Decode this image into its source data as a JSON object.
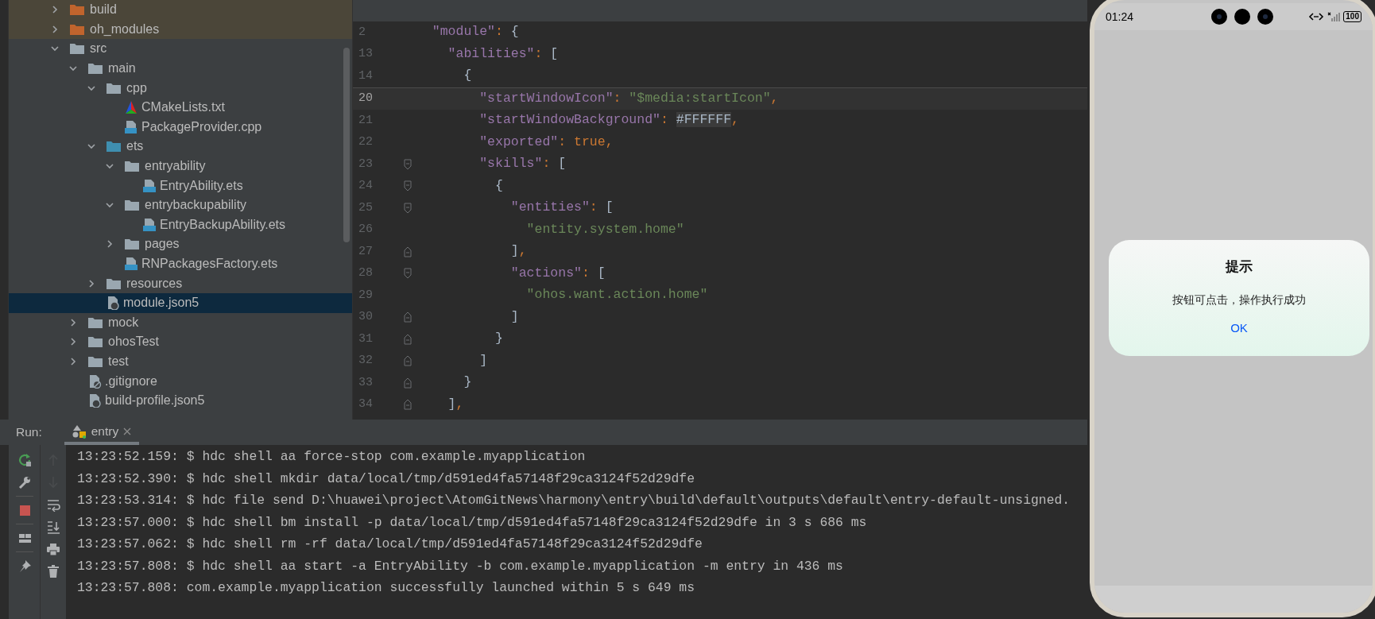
{
  "project_tree": [
    {
      "name": "build",
      "kind": "excluded-folder",
      "expanded": false,
      "selected": false
    },
    {
      "name": "oh_modules",
      "kind": "excluded-folder",
      "expanded": false,
      "selected": false
    },
    {
      "name": "src",
      "kind": "folder",
      "expanded": true,
      "selected": false,
      "children": [
        {
          "name": "main",
          "kind": "folder",
          "expanded": true,
          "selected": false,
          "children": [
            {
              "name": "cpp",
              "kind": "folder",
              "expanded": true,
              "selected": false,
              "children": [
                {
                  "name": "CMakeLists.txt",
                  "kind": "cmake-file",
                  "selected": false
                },
                {
                  "name": "PackageProvider.cpp",
                  "kind": "cpp-file",
                  "selected": false
                }
              ]
            },
            {
              "name": "ets",
              "kind": "source-folder",
              "expanded": true,
              "selected": false,
              "children": [
                {
                  "name": "entryability",
                  "kind": "folder",
                  "expanded": true,
                  "selected": false,
                  "children": [
                    {
                      "name": "EntryAbility.ets",
                      "kind": "ets-file",
                      "selected": false
                    }
                  ]
                },
                {
                  "name": "entrybackupability",
                  "kind": "folder",
                  "expanded": true,
                  "selected": false,
                  "children": [
                    {
                      "name": "EntryBackupAbility.ets",
                      "kind": "ets-file",
                      "selected": false
                    }
                  ]
                },
                {
                  "name": "pages",
                  "kind": "folder",
                  "expanded": false,
                  "selected": false
                },
                {
                  "name": "RNPackagesFactory.ets",
                  "kind": "ets-file",
                  "selected": false
                }
              ]
            },
            {
              "name": "resources",
              "kind": "folder",
              "expanded": false,
              "selected": false
            },
            {
              "name": "module.json5",
              "kind": "json-file",
              "selected": true
            }
          ]
        },
        {
          "name": "mock",
          "kind": "folder",
          "expanded": false,
          "selected": false
        },
        {
          "name": "ohosTest",
          "kind": "folder",
          "expanded": false,
          "selected": false
        },
        {
          "name": "test",
          "kind": "folder",
          "expanded": false,
          "selected": false
        },
        {
          "name": ".gitignore",
          "kind": "ignore-file",
          "selected": false
        },
        {
          "name": "build-profile.json5",
          "kind": "json-file",
          "selected": false
        }
      ]
    }
  ],
  "editor": {
    "sticky_lines": [
      {
        "number": "2",
        "current": false,
        "tokens": [
          {
            "text": "  \"module\"",
            "kind": "key"
          },
          {
            "text": ": ",
            "kind": "punct"
          },
          {
            "text": "{",
            "kind": "bracket"
          }
        ]
      },
      {
        "number": "13",
        "current": false,
        "tokens": [
          {
            "text": "    \"abilities\"",
            "kind": "key"
          },
          {
            "text": ": ",
            "kind": "punct"
          },
          {
            "text": "[",
            "kind": "bracket"
          }
        ]
      },
      {
        "number": "14",
        "current": false,
        "tokens": [
          {
            "text": "      {",
            "kind": "bracket"
          }
        ]
      }
    ],
    "lines": [
      {
        "number": "20",
        "current": true,
        "tokens": [
          {
            "text": "        \"startWindowIcon\"",
            "kind": "key"
          },
          {
            "text": ": ",
            "kind": "punct"
          },
          {
            "text": "\"$media:startIcon\"",
            "kind": "string"
          },
          {
            "text": ",",
            "kind": "punct"
          }
        ]
      },
      {
        "number": "21",
        "current": false,
        "tokens": [
          {
            "text": "        \"startWindowBackground\"",
            "kind": "key"
          },
          {
            "text": ": ",
            "kind": "punct"
          },
          {
            "text": "#FFFFFF",
            "kind": "marked"
          },
          {
            "text": ",",
            "kind": "punct"
          }
        ]
      },
      {
        "number": "22",
        "current": false,
        "tokens": [
          {
            "text": "        \"exported\"",
            "kind": "key"
          },
          {
            "text": ": ",
            "kind": "punct"
          },
          {
            "text": "true",
            "kind": "literal"
          },
          {
            "text": ",",
            "kind": "punct"
          }
        ]
      },
      {
        "number": "23",
        "current": false,
        "kind": "fold-start",
        "tokens": [
          {
            "text": "        \"skills\"",
            "kind": "key"
          },
          {
            "text": ": ",
            "kind": "punct"
          },
          {
            "text": "[",
            "kind": "bracket"
          }
        ]
      },
      {
        "number": "24",
        "current": false,
        "kind": "fold-start",
        "tokens": [
          {
            "text": "          {",
            "kind": "bracket"
          }
        ]
      },
      {
        "number": "25",
        "current": false,
        "kind": "fold-start",
        "tokens": [
          {
            "text": "            \"entities\"",
            "kind": "key"
          },
          {
            "text": ": ",
            "kind": "punct"
          },
          {
            "text": "[",
            "kind": "bracket"
          }
        ]
      },
      {
        "number": "26",
        "current": false,
        "tokens": [
          {
            "text": "              \"entity.system.home\"",
            "kind": "string"
          }
        ]
      },
      {
        "number": "27",
        "current": false,
        "kind": "fold-end",
        "tokens": [
          {
            "text": "            ]",
            "kind": "bracket"
          },
          {
            "text": ",",
            "kind": "punct"
          }
        ]
      },
      {
        "number": "28",
        "current": false,
        "kind": "fold-start",
        "tokens": [
          {
            "text": "            \"actions\"",
            "kind": "key"
          },
          {
            "text": ": ",
            "kind": "punct"
          },
          {
            "text": "[",
            "kind": "bracket"
          }
        ]
      },
      {
        "number": "29",
        "current": false,
        "tokens": [
          {
            "text": "              \"ohos.want.action.home\"",
            "kind": "string"
          }
        ]
      },
      {
        "number": "30",
        "current": false,
        "kind": "fold-end",
        "tokens": [
          {
            "text": "            ]",
            "kind": "bracket"
          }
        ]
      },
      {
        "number": "31",
        "current": false,
        "kind": "fold-end",
        "tokens": [
          {
            "text": "          }",
            "kind": "bracket"
          }
        ]
      },
      {
        "number": "32",
        "current": false,
        "kind": "fold-end",
        "tokens": [
          {
            "text": "        ]",
            "kind": "bracket"
          }
        ]
      },
      {
        "number": "33",
        "current": false,
        "kind": "fold-end",
        "tokens": [
          {
            "text": "      }",
            "kind": "bracket"
          }
        ]
      },
      {
        "number": "34",
        "current": false,
        "kind": "fold-end",
        "tokens": [
          {
            "text": "    ]",
            "kind": "bracket"
          },
          {
            "text": ",",
            "kind": "punct"
          }
        ]
      }
    ]
  },
  "run_panel": {
    "label": "Run:",
    "tabs": [
      {
        "label": "entry",
        "selected": true
      }
    ],
    "toolbar_left": [
      {
        "kind": "rerun",
        "disabled": false
      },
      {
        "kind": "settings",
        "disabled": false
      },
      {
        "kind": "stop",
        "disabled": false
      },
      {
        "kind": "layout",
        "disabled": false
      },
      {
        "kind": "pin",
        "disabled": false
      }
    ],
    "toolbar_right": [
      {
        "kind": "up",
        "disabled": true
      },
      {
        "kind": "down",
        "disabled": true
      },
      {
        "kind": "wrap",
        "disabled": false
      },
      {
        "kind": "scroll-end",
        "disabled": false
      },
      {
        "kind": "print",
        "disabled": false
      },
      {
        "kind": "trash",
        "disabled": false
      }
    ],
    "console": [
      "13:23:52.159: $ hdc shell aa force-stop com.example.myapplication",
      "13:23:52.390: $ hdc shell mkdir data/local/tmp/d591ed4fa57148f29ca3124f52d29dfe",
      "13:23:53.314: $ hdc file send D:\\huawei\\project\\AtomGitNews\\harmony\\entry\\build\\default\\outputs\\default\\entry-default-unsigned.",
      "13:23:57.000: $ hdc shell bm install -p data/local/tmp/d591ed4fa57148f29ca3124f52d29dfe in 3 s 686 ms",
      "13:23:57.062: $ hdc shell rm -rf data/local/tmp/d591ed4fa57148f29ca3124f52d29dfe",
      "13:23:57.808: $ hdc shell aa start -a EntryAbility -b com.example.myapplication -m entry in 436 ms",
      "13:23:57.808: com.example.myapplication successfully launched within 5 s 649 ms"
    ]
  },
  "phone": {
    "status_bar": {
      "time": "01:24",
      "battery": "100"
    },
    "dialog": {
      "title": "提示",
      "message": "按钮可点击，操作执行成功",
      "button": "OK"
    }
  }
}
